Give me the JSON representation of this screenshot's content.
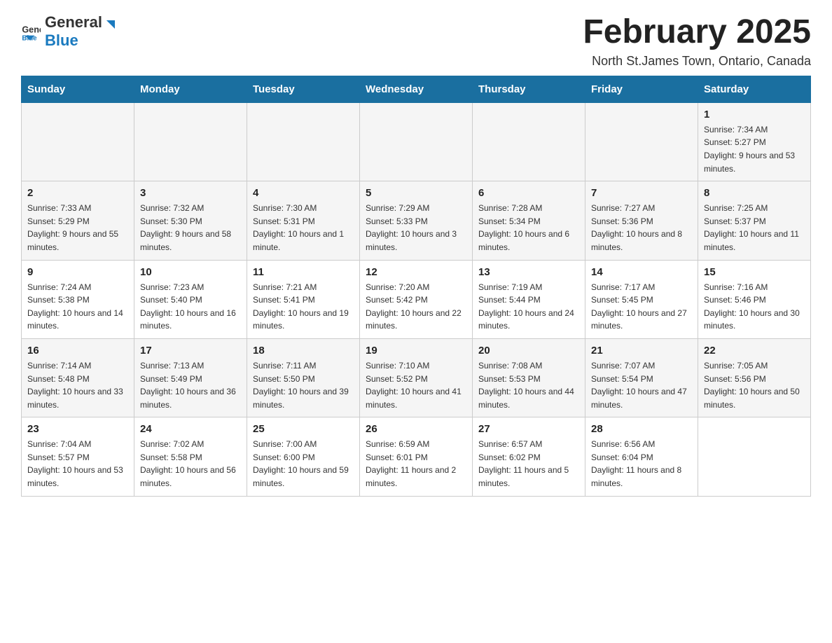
{
  "logo": {
    "text_general": "General",
    "text_blue": "Blue"
  },
  "title": "February 2025",
  "subtitle": "North St.James Town, Ontario, Canada",
  "days_of_week": [
    "Sunday",
    "Monday",
    "Tuesday",
    "Wednesday",
    "Thursday",
    "Friday",
    "Saturday"
  ],
  "weeks": [
    {
      "days": [
        {
          "num": "",
          "info": ""
        },
        {
          "num": "",
          "info": ""
        },
        {
          "num": "",
          "info": ""
        },
        {
          "num": "",
          "info": ""
        },
        {
          "num": "",
          "info": ""
        },
        {
          "num": "",
          "info": ""
        },
        {
          "num": "1",
          "info": "Sunrise: 7:34 AM\nSunset: 5:27 PM\nDaylight: 9 hours and 53 minutes."
        }
      ]
    },
    {
      "days": [
        {
          "num": "2",
          "info": "Sunrise: 7:33 AM\nSunset: 5:29 PM\nDaylight: 9 hours and 55 minutes."
        },
        {
          "num": "3",
          "info": "Sunrise: 7:32 AM\nSunset: 5:30 PM\nDaylight: 9 hours and 58 minutes."
        },
        {
          "num": "4",
          "info": "Sunrise: 7:30 AM\nSunset: 5:31 PM\nDaylight: 10 hours and 1 minute."
        },
        {
          "num": "5",
          "info": "Sunrise: 7:29 AM\nSunset: 5:33 PM\nDaylight: 10 hours and 3 minutes."
        },
        {
          "num": "6",
          "info": "Sunrise: 7:28 AM\nSunset: 5:34 PM\nDaylight: 10 hours and 6 minutes."
        },
        {
          "num": "7",
          "info": "Sunrise: 7:27 AM\nSunset: 5:36 PM\nDaylight: 10 hours and 8 minutes."
        },
        {
          "num": "8",
          "info": "Sunrise: 7:25 AM\nSunset: 5:37 PM\nDaylight: 10 hours and 11 minutes."
        }
      ]
    },
    {
      "days": [
        {
          "num": "9",
          "info": "Sunrise: 7:24 AM\nSunset: 5:38 PM\nDaylight: 10 hours and 14 minutes."
        },
        {
          "num": "10",
          "info": "Sunrise: 7:23 AM\nSunset: 5:40 PM\nDaylight: 10 hours and 16 minutes."
        },
        {
          "num": "11",
          "info": "Sunrise: 7:21 AM\nSunset: 5:41 PM\nDaylight: 10 hours and 19 minutes."
        },
        {
          "num": "12",
          "info": "Sunrise: 7:20 AM\nSunset: 5:42 PM\nDaylight: 10 hours and 22 minutes."
        },
        {
          "num": "13",
          "info": "Sunrise: 7:19 AM\nSunset: 5:44 PM\nDaylight: 10 hours and 24 minutes."
        },
        {
          "num": "14",
          "info": "Sunrise: 7:17 AM\nSunset: 5:45 PM\nDaylight: 10 hours and 27 minutes."
        },
        {
          "num": "15",
          "info": "Sunrise: 7:16 AM\nSunset: 5:46 PM\nDaylight: 10 hours and 30 minutes."
        }
      ]
    },
    {
      "days": [
        {
          "num": "16",
          "info": "Sunrise: 7:14 AM\nSunset: 5:48 PM\nDaylight: 10 hours and 33 minutes."
        },
        {
          "num": "17",
          "info": "Sunrise: 7:13 AM\nSunset: 5:49 PM\nDaylight: 10 hours and 36 minutes."
        },
        {
          "num": "18",
          "info": "Sunrise: 7:11 AM\nSunset: 5:50 PM\nDaylight: 10 hours and 39 minutes."
        },
        {
          "num": "19",
          "info": "Sunrise: 7:10 AM\nSunset: 5:52 PM\nDaylight: 10 hours and 41 minutes."
        },
        {
          "num": "20",
          "info": "Sunrise: 7:08 AM\nSunset: 5:53 PM\nDaylight: 10 hours and 44 minutes."
        },
        {
          "num": "21",
          "info": "Sunrise: 7:07 AM\nSunset: 5:54 PM\nDaylight: 10 hours and 47 minutes."
        },
        {
          "num": "22",
          "info": "Sunrise: 7:05 AM\nSunset: 5:56 PM\nDaylight: 10 hours and 50 minutes."
        }
      ]
    },
    {
      "days": [
        {
          "num": "23",
          "info": "Sunrise: 7:04 AM\nSunset: 5:57 PM\nDaylight: 10 hours and 53 minutes."
        },
        {
          "num": "24",
          "info": "Sunrise: 7:02 AM\nSunset: 5:58 PM\nDaylight: 10 hours and 56 minutes."
        },
        {
          "num": "25",
          "info": "Sunrise: 7:00 AM\nSunset: 6:00 PM\nDaylight: 10 hours and 59 minutes."
        },
        {
          "num": "26",
          "info": "Sunrise: 6:59 AM\nSunset: 6:01 PM\nDaylight: 11 hours and 2 minutes."
        },
        {
          "num": "27",
          "info": "Sunrise: 6:57 AM\nSunset: 6:02 PM\nDaylight: 11 hours and 5 minutes."
        },
        {
          "num": "28",
          "info": "Sunrise: 6:56 AM\nSunset: 6:04 PM\nDaylight: 11 hours and 8 minutes."
        },
        {
          "num": "",
          "info": ""
        }
      ]
    }
  ]
}
